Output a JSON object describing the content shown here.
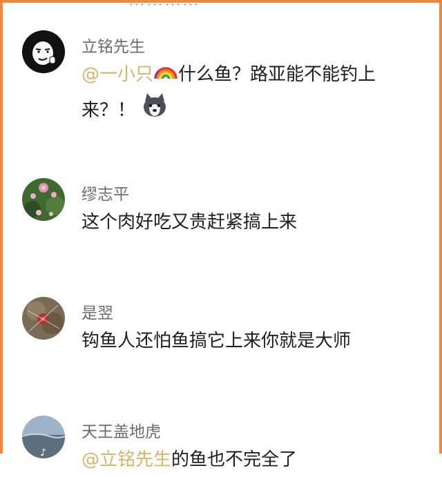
{
  "header": {
    "cut_text": "…………"
  },
  "comments": [
    {
      "username": "立铭先生",
      "mention": "@一小只",
      "text_line1": "什么鱼？路亚能不能钓上",
      "text_line2": "来？！",
      "emojis": [
        "rainbow-emoji",
        "husky-emoji"
      ]
    },
    {
      "username": "缪志平",
      "text": "这个肉好吃又贵赶紧搞上来"
    },
    {
      "username": "是翌",
      "text": "钩鱼人还怕鱼搞它上来你就是大师"
    },
    {
      "username": "天王盖地虎",
      "mention": "@立铭先生",
      "text": "的鱼也不完全了"
    }
  ],
  "colors": {
    "frame": "#f0883e",
    "mention": "#d6b46a",
    "username": "#6b6b6b",
    "text": "#1e1e1e"
  }
}
